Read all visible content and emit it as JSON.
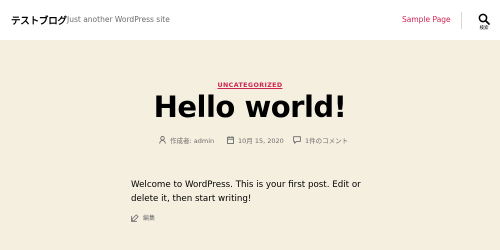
{
  "header": {
    "site_title": "テストブログ",
    "site_description": "Just another WordPress site",
    "nav": [
      {
        "label": "Sample Page"
      }
    ],
    "search_label": "検索"
  },
  "post": {
    "category": "UNCATEGORIZED",
    "title": "Hello world!",
    "meta": {
      "author": "作成者: admin",
      "date": "10月 15, 2020",
      "comments": "1件のコメント"
    },
    "content": "Welcome to WordPress. This is your first post. Edit or delete it, then start writing!",
    "edit_label": "編集"
  },
  "colors": {
    "accent": "#cd2653",
    "background": "#f5efe0",
    "header_background": "#ffffff",
    "meta_text": "#6d6d6d"
  },
  "icons": [
    "search-icon",
    "user-icon",
    "calendar-icon",
    "comment-icon",
    "edit-icon"
  ]
}
